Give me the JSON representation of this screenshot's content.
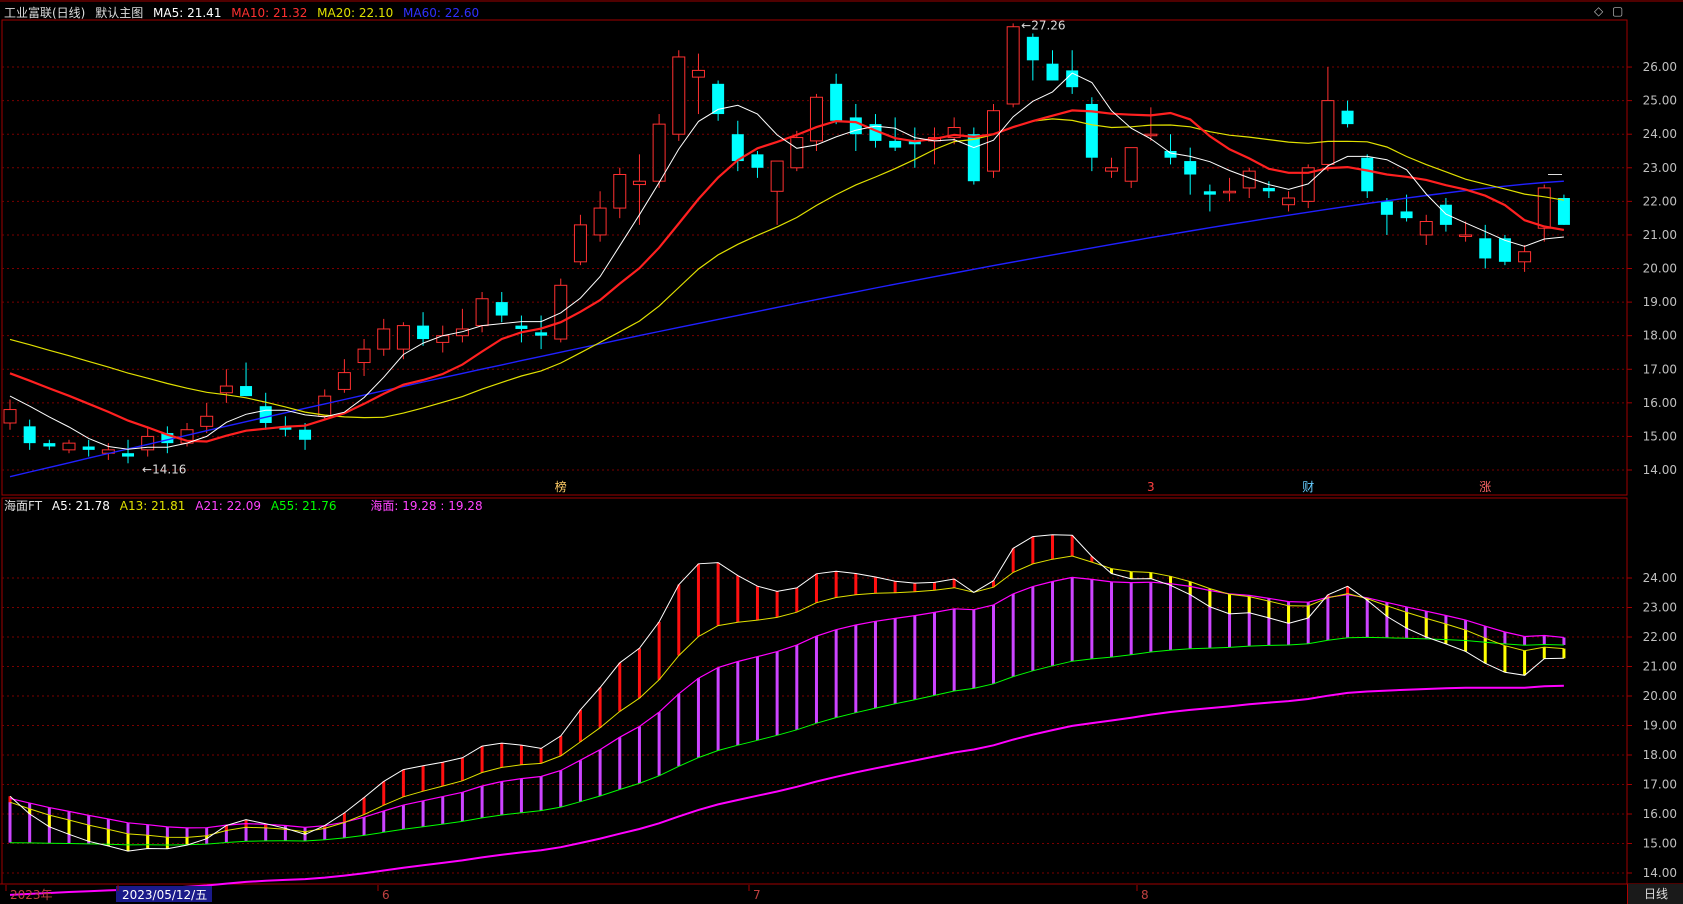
{
  "header_main": {
    "stock": "工业富联(日线)",
    "template": "默认主图",
    "ma5": "MA5: 21.41",
    "ma10": "MA10: 21.32",
    "ma20": "MA20: 22.10",
    "ma60": "MA60: 22.60"
  },
  "header_sub": {
    "name": "海面FT",
    "a5": "A5: 21.78",
    "a13": "A13: 21.81",
    "a21": "A21: 22.09",
    "a55": "A55: 21.76",
    "haimian": "海面: 19.28 : 19.28"
  },
  "controls": {
    "diamond": "◇",
    "square": "▢",
    "period": "日线"
  },
  "colors": {
    "up": "#ff3030",
    "down": "#00ffff",
    "ma5": "#ffffff",
    "ma10": "#ff2020",
    "ma20": "#e0e000",
    "ma60": "#2020ff",
    "a55": "#00ff00",
    "a21": "#ff00ff",
    "purple_bar": "#cc44ff"
  },
  "chart_data": [
    {
      "type": "candlestick",
      "title": "工业富联(日线)",
      "ylim": [
        13.6,
        27.6
      ],
      "y_ticks": [
        "14.00",
        "15.00",
        "16.00",
        "17.00",
        "18.00",
        "19.00",
        "20.00",
        "21.00",
        "22.00",
        "23.00",
        "24.00",
        "25.00",
        "26.00"
      ],
      "annotations": {
        "high": "27.26",
        "low": "14.16"
      },
      "event_markers": [
        "榜",
        "3",
        "财",
        "涨"
      ],
      "ohlc": [
        [
          15.4,
          16.1,
          15.2,
          15.8
        ],
        [
          15.3,
          15.5,
          14.6,
          14.8
        ],
        [
          14.8,
          14.9,
          14.6,
          14.7
        ],
        [
          14.6,
          14.9,
          14.5,
          14.8
        ],
        [
          14.7,
          14.9,
          14.4,
          14.6
        ],
        [
          14.5,
          14.8,
          14.3,
          14.6
        ],
        [
          14.5,
          14.9,
          14.2,
          14.4
        ],
        [
          14.6,
          15.3,
          14.4,
          15.0
        ],
        [
          15.1,
          15.3,
          14.5,
          14.8
        ],
        [
          14.8,
          15.4,
          14.7,
          15.2
        ],
        [
          15.3,
          16.0,
          15.1,
          15.6
        ],
        [
          16.3,
          17.0,
          16.0,
          16.5
        ],
        [
          16.5,
          17.2,
          16.2,
          16.2
        ],
        [
          15.9,
          16.3,
          15.2,
          15.4
        ],
        [
          15.3,
          15.6,
          15.0,
          15.2
        ],
        [
          15.2,
          15.4,
          14.6,
          14.9
        ],
        [
          15.6,
          16.4,
          15.5,
          16.2
        ],
        [
          16.4,
          17.3,
          16.3,
          16.9
        ],
        [
          17.2,
          17.9,
          16.8,
          17.6
        ],
        [
          17.6,
          18.5,
          17.4,
          18.2
        ],
        [
          17.6,
          18.4,
          17.3,
          18.3
        ],
        [
          18.3,
          18.7,
          17.7,
          17.9
        ],
        [
          17.8,
          18.3,
          17.5,
          18.0
        ],
        [
          18.0,
          18.8,
          17.8,
          18.2
        ],
        [
          18.3,
          19.3,
          18.1,
          19.1
        ],
        [
          19.0,
          19.3,
          18.4,
          18.6
        ],
        [
          18.3,
          18.6,
          17.8,
          18.2
        ],
        [
          18.1,
          18.6,
          17.6,
          18.0
        ],
        [
          17.9,
          19.7,
          17.8,
          19.5
        ],
        [
          20.2,
          21.6,
          20.1,
          21.3
        ],
        [
          21.0,
          22.3,
          20.8,
          21.8
        ],
        [
          21.8,
          23.0,
          21.5,
          22.8
        ],
        [
          22.5,
          23.4,
          21.3,
          22.6
        ],
        [
          22.6,
          24.6,
          22.4,
          24.3
        ],
        [
          24.0,
          26.5,
          23.8,
          26.3
        ],
        [
          25.7,
          26.4,
          24.6,
          25.9
        ],
        [
          25.5,
          25.6,
          24.4,
          24.6
        ],
        [
          24.0,
          24.4,
          22.9,
          23.2
        ],
        [
          23.4,
          23.5,
          22.7,
          23.0
        ],
        [
          22.3,
          23.2,
          21.3,
          23.2
        ],
        [
          23.0,
          24.1,
          22.9,
          23.9
        ],
        [
          23.8,
          25.2,
          23.5,
          25.1
        ],
        [
          25.5,
          25.8,
          24.3,
          24.4
        ],
        [
          24.5,
          24.9,
          23.5,
          24.0
        ],
        [
          24.3,
          24.6,
          23.6,
          23.8
        ],
        [
          23.8,
          24.5,
          23.5,
          23.6
        ],
        [
          23.8,
          24.2,
          23.0,
          23.7
        ],
        [
          23.8,
          24.2,
          23.1,
          23.9
        ],
        [
          23.9,
          24.5,
          23.7,
          24.2
        ],
        [
          24.0,
          24.2,
          22.5,
          22.6
        ],
        [
          22.9,
          24.9,
          22.7,
          24.7
        ],
        [
          24.9,
          27.3,
          24.8,
          27.2
        ],
        [
          26.9,
          27.0,
          25.6,
          26.2
        ],
        [
          26.1,
          26.5,
          25.6,
          25.6
        ],
        [
          25.9,
          26.5,
          25.2,
          25.4
        ],
        [
          24.9,
          25.1,
          22.9,
          23.3
        ],
        [
          22.9,
          23.3,
          22.7,
          23.0
        ],
        [
          22.6,
          23.6,
          22.4,
          23.6
        ],
        [
          24.0,
          24.8,
          23.8,
          24.0
        ],
        [
          23.5,
          24.0,
          23.1,
          23.3
        ],
        [
          23.2,
          23.6,
          22.2,
          22.8
        ],
        [
          22.3,
          22.5,
          21.7,
          22.2
        ],
        [
          22.3,
          22.7,
          22.0,
          22.3
        ],
        [
          22.4,
          23.0,
          22.1,
          22.9
        ],
        [
          22.4,
          22.6,
          22.1,
          22.3
        ],
        [
          21.9,
          22.3,
          21.7,
          22.1
        ],
        [
          22.0,
          23.1,
          21.8,
          23.0
        ],
        [
          23.1,
          26.0,
          22.9,
          25.0
        ],
        [
          24.7,
          25.0,
          24.2,
          24.3
        ],
        [
          23.3,
          23.4,
          22.1,
          22.3
        ],
        [
          22.0,
          22.1,
          21.0,
          21.6
        ],
        [
          21.7,
          22.2,
          21.4,
          21.5
        ],
        [
          21.0,
          21.6,
          20.7,
          21.4
        ],
        [
          21.9,
          22.1,
          21.1,
          21.3
        ],
        [
          21.0,
          21.4,
          20.8,
          21.0
        ],
        [
          20.9,
          21.3,
          20.0,
          20.3
        ],
        [
          20.9,
          21.0,
          20.1,
          20.2
        ],
        [
          20.2,
          20.7,
          19.9,
          20.5
        ],
        [
          21.2,
          22.5,
          20.8,
          22.4
        ],
        [
          22.1,
          22.2,
          21.3,
          21.3
        ]
      ]
    },
    {
      "type": "line",
      "title": "海面FT",
      "ylim": [
        13.5,
        24.9
      ],
      "y_ticks": [
        "14.00",
        "15.00",
        "16.00",
        "17.00",
        "18.00",
        "19.00",
        "20.00",
        "21.00",
        "22.00",
        "23.00",
        "24.00"
      ]
    }
  ],
  "x_labels": [
    "2023年",
    "2023/05/12/五",
    "6",
    "7",
    "8"
  ]
}
